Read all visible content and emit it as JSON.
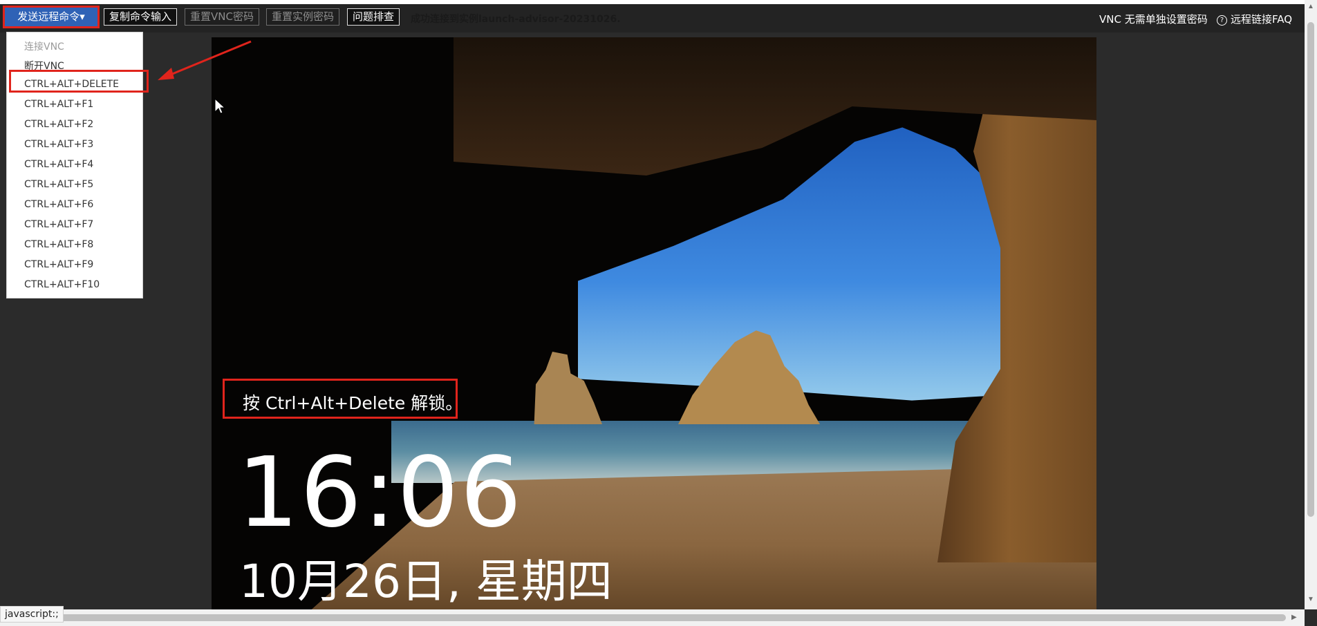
{
  "toolbar": {
    "send_command": "发送远程命令",
    "copy_input": "复制命令输入",
    "reset_vnc_password": "重置VNC密码",
    "reset_instance_password": "重置实例密码",
    "troubleshoot": "问题排查",
    "status": "成功连接到实例launch-advisor-20231026.",
    "vnc_no_password": "VNC 无需单独设置密码",
    "faq": "远程链接FAQ"
  },
  "dropdown": {
    "items": [
      "连接VNC",
      "断开VNC",
      "CTRL+ALT+DELETE",
      "CTRL+ALT+F1",
      "CTRL+ALT+F2",
      "CTRL+ALT+F3",
      "CTRL+ALT+F4",
      "CTRL+ALT+F5",
      "CTRL+ALT+F6",
      "CTRL+ALT+F7",
      "CTRL+ALT+F8",
      "CTRL+ALT+F9",
      "CTRL+ALT+F10"
    ]
  },
  "lockscreen": {
    "message": "按 Ctrl+Alt+Delete 解锁。",
    "time": "16:06",
    "date": "10月26日, 星期四"
  },
  "statusbar": {
    "text": "javascript:;"
  },
  "icons": {
    "help": "help-circle-icon",
    "caret": "caret-down-icon"
  },
  "colors": {
    "primary": "#2f62b6",
    "highlight": "#e0241c"
  }
}
